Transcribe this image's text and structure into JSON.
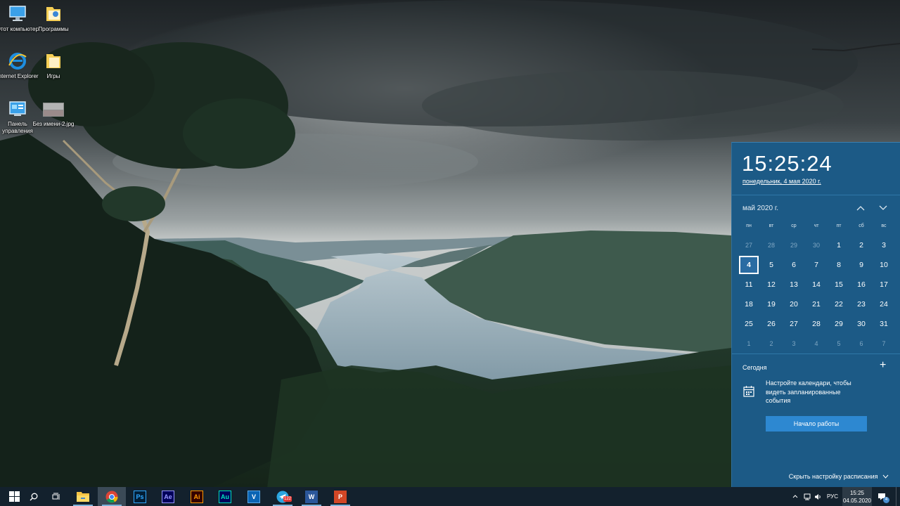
{
  "desktop": {
    "icons": [
      {
        "label": "Этот компьютер",
        "icon": "this-pc-icon"
      },
      {
        "label": "Программы",
        "icon": "folder-icon"
      },
      {
        "label": "Internet Explorer",
        "icon": "internet-explorer-icon"
      },
      {
        "label": "Игры",
        "icon": "folder-icon"
      },
      {
        "label": "Панель управления",
        "icon": "control-panel-icon"
      },
      {
        "label": "Без имени-2.jpg",
        "icon": "image-file-icon"
      }
    ]
  },
  "calendar": {
    "time": "15:25:24",
    "date_long": "понедельник, 4 мая 2020 г.",
    "month_label": "май 2020 г.",
    "prev_icon": "chevron-up-icon",
    "next_icon": "chevron-down-icon",
    "weekdays": [
      "пн",
      "вт",
      "ср",
      "чт",
      "пт",
      "сб",
      "вс"
    ],
    "weeks": [
      [
        "27",
        "28",
        "29",
        "30",
        "1",
        "2",
        "3"
      ],
      [
        "4",
        "5",
        "6",
        "7",
        "8",
        "9",
        "10"
      ],
      [
        "11",
        "12",
        "13",
        "14",
        "15",
        "16",
        "17"
      ],
      [
        "18",
        "19",
        "20",
        "21",
        "22",
        "23",
        "24"
      ],
      [
        "25",
        "26",
        "27",
        "28",
        "29",
        "30",
        "31"
      ],
      [
        "1",
        "2",
        "3",
        "4",
        "5",
        "6",
        "7"
      ]
    ],
    "today": "4",
    "agenda": {
      "title": "Сегодня",
      "add_label": "+",
      "message": "Настройте календари, чтобы видеть запланированные события",
      "button_label": "Начало работы",
      "hide_label": "Скрыть настройку расписания"
    }
  },
  "taskbar": {
    "apps": [
      {
        "name": "file-explorer",
        "icon": "folder-icon",
        "tile": ""
      },
      {
        "name": "chrome",
        "icon": "chrome-icon",
        "tile": ""
      },
      {
        "name": "photoshop",
        "icon": "photoshop-icon",
        "tile": "Ps",
        "fg": "#31a8ff",
        "bg": "#001e36"
      },
      {
        "name": "after-effects",
        "icon": "after-effects-icon",
        "tile": "Ae",
        "fg": "#9999ff",
        "bg": "#00005b"
      },
      {
        "name": "illustrator",
        "icon": "illustrator-icon",
        "tile": "Ai",
        "fg": "#ff9a00",
        "bg": "#330000"
      },
      {
        "name": "audition",
        "icon": "audition-icon",
        "tile": "Au",
        "fg": "#00e4bb",
        "bg": "#00005b"
      },
      {
        "name": "vegas",
        "icon": "v-app-icon",
        "tile": "V",
        "fg": "#ffffff",
        "bg": "#0a64b4"
      },
      {
        "name": "telegram",
        "icon": "telegram-icon",
        "tile": "",
        "badge": "122"
      },
      {
        "name": "word",
        "icon": "word-icon",
        "tile": "W",
        "fg": "#ffffff",
        "bg": "#2b579a"
      },
      {
        "name": "powerpoint",
        "icon": "powerpoint-icon",
        "tile": "P",
        "fg": "#ffffff",
        "bg": "#d24726"
      }
    ],
    "tray": {
      "language": "РУС",
      "time": "15:25",
      "date": "04.05.2020",
      "notification_count": "4"
    }
  },
  "colors": {
    "flyout_bg": "#1c5a86",
    "taskbar_bg": "#13212d",
    "accent": "#2d88d1"
  }
}
